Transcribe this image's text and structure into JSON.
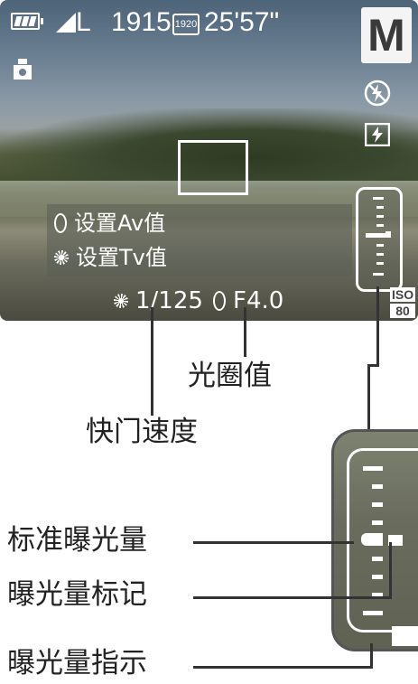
{
  "status_bar": {
    "quality": "L",
    "shots_remaining": "1915",
    "movie_quality": "1920",
    "record_time": "25'57\""
  },
  "mode": "M",
  "menu": {
    "item_av": "设置Av值",
    "item_tv": "设置Tv值"
  },
  "exposure": {
    "shutter_speed": "1/125",
    "aperture": "F4.0"
  },
  "iso": {
    "label": "ISO",
    "value": "80"
  },
  "annotations": {
    "aperture_value": "光圈值",
    "shutter_speed": "快门速度",
    "standard_exposure": "标准曝光量",
    "exposure_mark": "曝光量标记",
    "exposure_indicator": "曝光量指示"
  },
  "icons": [
    "battery-icon",
    "image-size-icon",
    "movie-quality-icon",
    "camera-orientation-icon",
    "flash-off-icon",
    "image-stabilizer-icon",
    "control-ring-icon",
    "control-dial-icon"
  ]
}
